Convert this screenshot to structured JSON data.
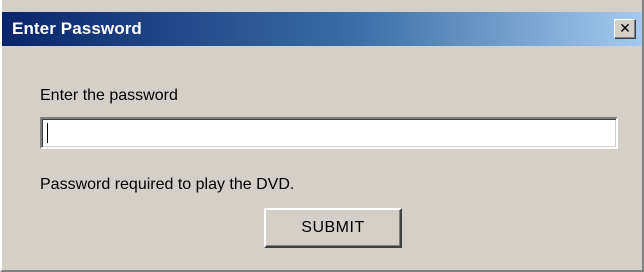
{
  "window": {
    "title": "Enter Password",
    "close_symbol": "✕",
    "close_icon_name": "close-icon"
  },
  "form": {
    "prompt_label": "Enter the password",
    "password_value": "",
    "status_text": "Password required to play the DVD.",
    "submit_label": "SUBMIT"
  },
  "colors": {
    "titlebar_start": "#0a246a",
    "titlebar_end": "#a6caf0",
    "dialog_background": "#d4d0c8"
  }
}
